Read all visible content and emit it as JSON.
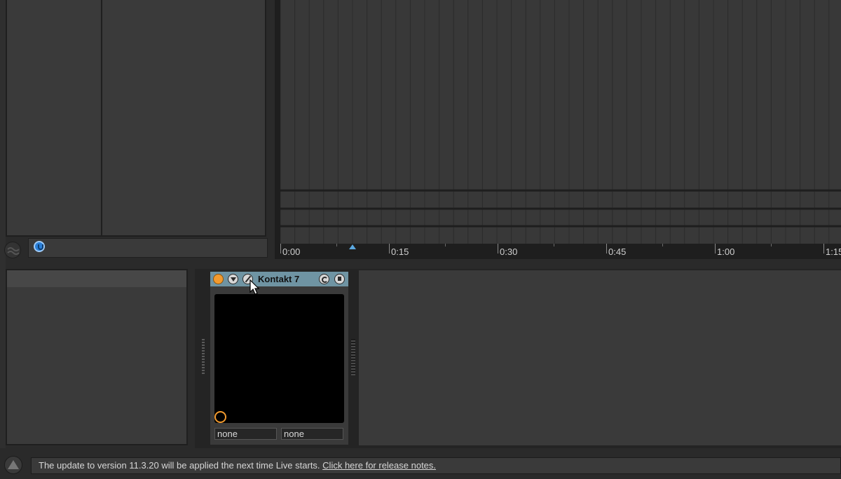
{
  "arrangement": {
    "ruler_labels": [
      "0:00",
      "0:15",
      "0:30",
      "0:45",
      "1:00",
      "1:15"
    ]
  },
  "device": {
    "name": "Kontakt 7",
    "macro_left": "none",
    "macro_right": "none"
  },
  "status_bar": {
    "message": "The update to version 11.3.20 will be applied the next time Live starts.",
    "link": "Click here for release notes."
  },
  "colors": {
    "device_title": "#6f94a3",
    "power_orange": "#f29a2e",
    "info_blue": "#2a7fd8",
    "play_marker": "#5ba8e0"
  },
  "icons": [
    "wave-icon",
    "info-icon",
    "power-icon",
    "fold-icon",
    "wrench-icon",
    "cycle-icon",
    "save-icon",
    "warning-triangle-icon",
    "mouse-cursor-icon"
  ]
}
